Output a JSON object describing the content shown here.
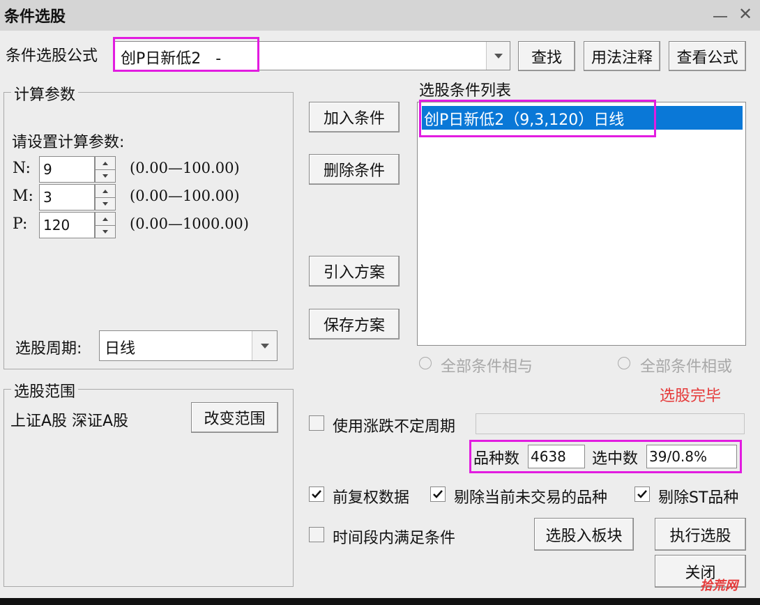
{
  "window": {
    "title": "条件选股"
  },
  "formula": {
    "label": "条件选股公式",
    "value": "创P日新低2   -",
    "find_btn": "查找",
    "usage_btn": "用法注释",
    "view_btn": "查看公式"
  },
  "calc": {
    "legend": "计算参数",
    "prompt": "请设置计算参数:",
    "params": [
      {
        "name": "N:",
        "value": "9",
        "range": "(0.00—100.00)"
      },
      {
        "name": "M:",
        "value": "3",
        "range": "(0.00—100.00)"
      },
      {
        "name": "P:",
        "value": "120",
        "range": "(0.00—1000.00)"
      }
    ],
    "period_label": "选股周期:",
    "period_value": "日线"
  },
  "scope": {
    "legend": "选股范围",
    "text": "上证A股 深证A股",
    "change_btn": "改变范围"
  },
  "actions": {
    "add": "加入条件",
    "delete": "删除条件",
    "import": "引入方案",
    "save": "保存方案"
  },
  "conditions": {
    "label": "选股条件列表",
    "items": [
      "创P日新低2（9,3,120）日线"
    ],
    "radio_and": "全部条件相与",
    "radio_or": "全部条件相或",
    "status": "选股完毕"
  },
  "options": {
    "use_variable_period": "使用涨跌不定周期",
    "variety_label": "品种数",
    "variety_value": "4638",
    "selected_label": "选中数",
    "selected_value": "39/0.8%",
    "pre_adjust": "前复权数据",
    "exclude_untraded": "剔除当前未交易的品种",
    "exclude_st": "剔除ST品种",
    "time_range": "时间段内满足条件"
  },
  "bottom": {
    "to_block_btn": "选股入板块",
    "execute_btn": "执行选股",
    "close_btn": "关闭",
    "watermark": "拾荒网"
  },
  "colors": {
    "highlight": "#e21ce0",
    "selection": "#0a78d7",
    "status_red": "#e53a3a"
  }
}
